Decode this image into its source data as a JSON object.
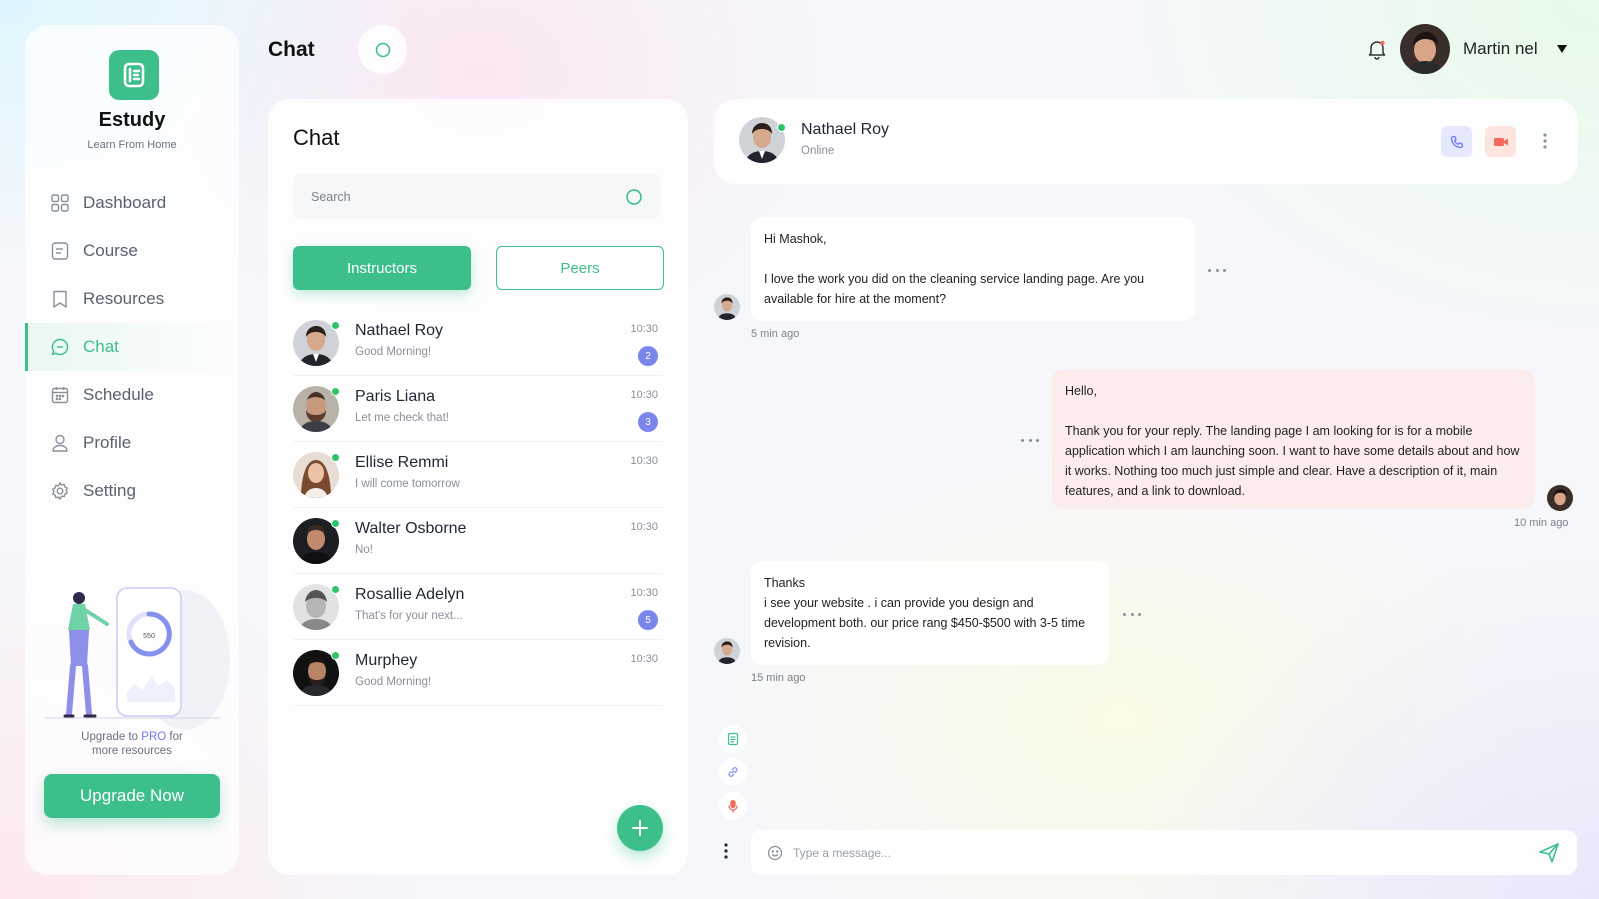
{
  "app": {
    "brand": "Estudy",
    "tagline": "Learn From Home"
  },
  "sidebar": {
    "items": [
      {
        "label": "Dashboard",
        "icon": "dashboard-icon",
        "active": false
      },
      {
        "label": "Course",
        "icon": "course-icon",
        "active": false
      },
      {
        "label": "Resources",
        "icon": "bookmark-icon",
        "active": false
      },
      {
        "label": "Chat",
        "icon": "chat-icon",
        "active": true
      },
      {
        "label": "Schedule",
        "icon": "calendar-icon",
        "active": false
      },
      {
        "label": "Profile",
        "icon": "user-icon",
        "active": false
      },
      {
        "label": "Setting",
        "icon": "gear-icon",
        "active": false
      }
    ],
    "promo": {
      "text_before": "Upgrade  to ",
      "text_pro": "PRO",
      "text_after": " for",
      "text_line2": "more resources",
      "illustration_value": "550"
    },
    "upgrade_label": "Upgrade Now"
  },
  "header": {
    "title": "Chat",
    "user_name": "Martin nel"
  },
  "chat_list": {
    "title": "Chat",
    "search_placeholder": "Search",
    "tabs": {
      "instructors": "Instructors",
      "peers": "Peers"
    },
    "contacts": [
      {
        "name": "Nathael Roy",
        "message": "Good Morning!",
        "time": "10:30",
        "unread": "2",
        "online": true
      },
      {
        "name": "Paris Liana",
        "message": "Let me check that!",
        "time": "10:30",
        "unread": "3",
        "online": true
      },
      {
        "name": "Ellise Remmi",
        "message": "I will come tomorrow",
        "time": "10:30",
        "unread": "",
        "online": true
      },
      {
        "name": "Walter Osborne",
        "message": "No!",
        "time": "10:30",
        "unread": "",
        "online": true
      },
      {
        "name": "Rosallie Adelyn",
        "message": "That's for your next...",
        "time": "10:30",
        "unread": "5",
        "online": true
      },
      {
        "name": "Murphey",
        "message": "Good Morning!",
        "time": "10:30",
        "unread": "",
        "online": true
      }
    ]
  },
  "conversation": {
    "name": "Nathael Roy",
    "status": "Online",
    "messages": [
      {
        "direction": "in",
        "text": "Hi Mashok,\n\nI love the work you did on the cleaning service landing page. Are you available for hire at the moment?",
        "time": "5 min ago"
      },
      {
        "direction": "out",
        "text": "Hello,\n\nThank you for your reply. The landing page I am looking for is for a mobile application which I am launching soon. I want to have some details about and how it works. Nothing too much just simple and clear. Have a description of it, main features, and a link to download.",
        "time": "10 min ago"
      },
      {
        "direction": "in",
        "text": "Thanks\ni see your website . i can provide you design and development both. our price rang $450-$500 with 3-5 time revision.",
        "time": "15 min ago"
      }
    ],
    "composer_placeholder": "Type a message..."
  },
  "colors": {
    "accent": "#3dbf8c",
    "badge": "#7b86ec",
    "online": "#2fc36b",
    "outgoing_bubble": "#fdecec"
  }
}
